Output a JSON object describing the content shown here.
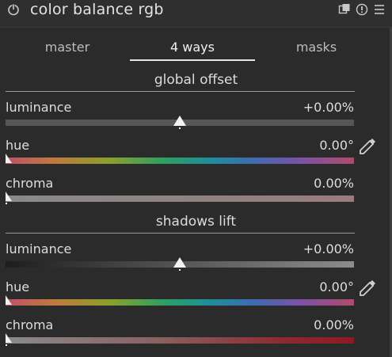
{
  "header": {
    "title": "color balance rgb",
    "icons": [
      "power-icon",
      "presets-icon",
      "reset-icon",
      "menu-icon"
    ]
  },
  "tabs": [
    {
      "label": "master"
    },
    {
      "label": "4 ways"
    },
    {
      "label": "masks"
    }
  ],
  "active_tab": "4 ways",
  "sections": {
    "global_offset": {
      "title": "global offset",
      "luminance": {
        "label": "luminance",
        "value": "+0.00%"
      },
      "hue": {
        "label": "hue",
        "value": "0.00°"
      },
      "chroma": {
        "label": "chroma",
        "value": "0.00%"
      }
    },
    "shadows_lift": {
      "title": "shadows lift",
      "luminance": {
        "label": "luminance",
        "value": "+0.00%"
      },
      "hue": {
        "label": "hue",
        "value": "0.00°"
      },
      "chroma": {
        "label": "chroma",
        "value": "0.00%"
      }
    }
  },
  "colors": {
    "background": "#2b2b2b",
    "hue_gradient": [
      "#c0506a",
      "#c07a3c",
      "#8aa02c",
      "#2fa060",
      "#1f8f98",
      "#3a6fb0",
      "#7a52a8",
      "#b04a8a"
    ]
  }
}
